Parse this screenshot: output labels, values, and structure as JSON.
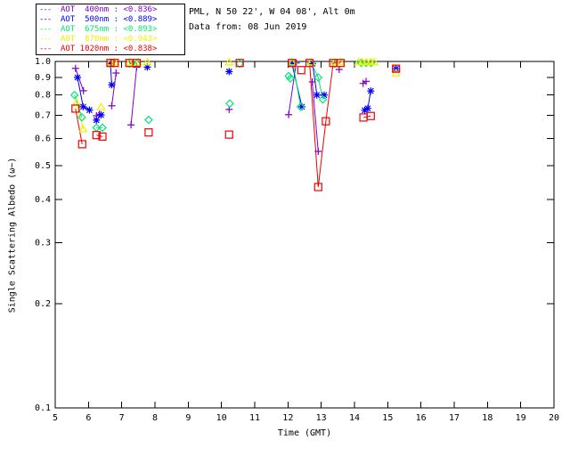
{
  "header": {
    "location_line": "PML, N 50 22', W 04 08', Alt 0m",
    "date_line": "Data from: 08 Jun 2019"
  },
  "legend": {
    "position": "top-left",
    "entries": [
      {
        "id": "aot-400",
        "dash": "---",
        "label": "AOT  400nm : <0.836>",
        "color": "#8000C8"
      },
      {
        "id": "aot-500",
        "dash": "---",
        "label": "AOT  500nm : <0.889>",
        "color": "#0000FF"
      },
      {
        "id": "aot-675",
        "dash": "---",
        "label": "AOT  675nm : <0.893>",
        "color": "#00E673"
      },
      {
        "id": "aot-870",
        "dash": "---",
        "label": "AOT  870nm : <0.943>",
        "color": "#F0F000"
      },
      {
        "id": "aot-1020",
        "dash": "---",
        "label": "AOT 1020nm : <0.838>",
        "color": "#F00000"
      }
    ]
  },
  "chart_data": {
    "type": "scatter",
    "title": "",
    "xlabel": "Time (GMT)",
    "ylabel": "Single Scattering Albedo (ω~)",
    "x_ticks": [
      "5",
      "6",
      "7",
      "8",
      "9",
      "10",
      "11",
      "12",
      "13",
      "14",
      "15",
      "16",
      "17",
      "18",
      "19",
      "20"
    ],
    "y_ticks": [
      "1.0",
      "0.9",
      "0.8",
      "0.7",
      "0.6",
      "0.5",
      "0.4",
      "0.3",
      "0.2",
      "0.1"
    ],
    "xlim": [
      5,
      20
    ],
    "ylim": [
      0.1,
      1.0
    ],
    "y_scale": "log",
    "grid": false,
    "axis_color": "#000000",
    "background": "#ffffff",
    "series": [
      {
        "name": "AOT 400nm",
        "wavelength": "400nm",
        "mean_label": "<0.836>",
        "color": "#8000C8",
        "marker": "plus",
        "segments": [
          [
            [
              5.61,
              0.955
            ],
            [
              5.85,
              0.823
            ]
          ],
          [
            [
              6.24,
              0.697
            ],
            [
              6.33,
              0.704
            ]
          ],
          [
            [
              6.7,
              0.745
            ],
            [
              6.83,
              0.926
            ]
          ],
          [
            [
              7.28,
              0.656
            ],
            [
              7.45,
              0.963
            ]
          ],
          [
            [
              10.23,
              0.727
            ]
          ],
          [
            [
              12.02,
              0.702
            ],
            [
              12.25,
              0.99
            ]
          ],
          [
            [
              12.73,
              0.873
            ],
            [
              12.91,
              0.55
            ]
          ],
          [
            [
              13.54,
              0.948
            ]
          ],
          [
            [
              14.26,
              0.864
            ],
            [
              14.35,
              0.876
            ]
          ]
        ]
      },
      {
        "name": "AOT 500nm",
        "wavelength": "500nm",
        "mean_label": "<0.889>",
        "color": "#0000FF",
        "marker": "asterisk",
        "segments": [
          [
            [
              5.67,
              0.899
            ],
            [
              5.84,
              0.74
            ],
            [
              6.03,
              0.724
            ]
          ],
          [
            [
              6.24,
              0.677
            ],
            [
              6.38,
              0.701
            ]
          ],
          [
            [
              6.66,
              0.985
            ],
            [
              6.7,
              0.856
            ]
          ],
          [
            [
              7.77,
              0.963
            ]
          ],
          [
            [
              10.23,
              0.935
            ]
          ],
          [
            [
              12.12,
              0.985
            ],
            [
              12.42,
              0.74
            ]
          ],
          [
            [
              12.74,
              0.985
            ],
            [
              12.87,
              0.8
            ],
            [
              13.09,
              0.8
            ]
          ],
          [
            [
              14.31,
              0.723
            ],
            [
              14.4,
              0.732
            ],
            [
              14.49,
              0.822
            ]
          ],
          [
            [
              15.25,
              0.953
            ]
          ]
        ]
      },
      {
        "name": "AOT 675nm",
        "wavelength": "675nm",
        "mean_label": "<0.893>",
        "color": "#00E673",
        "marker": "diamond",
        "segments": [
          [
            [
              5.58,
              0.8
            ],
            [
              5.8,
              0.69
            ]
          ],
          [
            [
              6.24,
              0.644
            ],
            [
              6.42,
              0.644
            ]
          ],
          [
            [
              6.66,
              0.985
            ]
          ],
          [
            [
              7.23,
              0.985
            ],
            [
              7.45,
              0.985
            ]
          ],
          [
            [
              7.81,
              0.678
            ]
          ],
          [
            [
              10.25,
              0.756
            ]
          ],
          [
            [
              10.55,
              0.985
            ]
          ],
          [
            [
              12.02,
              0.908
            ],
            [
              12.07,
              0.893
            ]
          ],
          [
            [
              12.15,
              0.99
            ],
            [
              12.38,
              0.74
            ]
          ],
          [
            [
              12.7,
              0.99
            ],
            [
              12.91,
              0.899
            ],
            [
              13.05,
              0.777
            ]
          ],
          [
            [
              13.41,
              0.985
            ]
          ],
          [
            [
              14.2,
              0.99
            ],
            [
              14.35,
              0.99
            ],
            [
              14.5,
              0.99
            ]
          ]
        ]
      },
      {
        "name": "AOT 870nm",
        "wavelength": "870nm",
        "mean_label": "<0.943>",
        "color": "#F0F000",
        "marker": "triangle",
        "segments": [
          [
            [
              5.64,
              0.76
            ],
            [
              5.84,
              0.638
            ]
          ],
          [
            [
              6.38,
              0.739
            ]
          ],
          [
            [
              6.66,
              0.995
            ],
            [
              6.79,
              0.995
            ]
          ],
          [
            [
              7.23,
              0.995
            ]
          ],
          [
            [
              7.5,
              0.995
            ]
          ],
          [
            [
              7.77,
              0.995
            ]
          ],
          [
            [
              10.23,
              0.995
            ]
          ],
          [
            [
              12.12,
              0.995
            ]
          ],
          [
            [
              12.7,
              0.995
            ]
          ],
          [
            [
              13.41,
              0.995
            ]
          ],
          [
            [
              13.58,
              0.995
            ]
          ],
          [
            [
              14.12,
              0.995
            ],
            [
              14.24,
              0.995
            ],
            [
              14.36,
              0.995
            ],
            [
              14.48,
              0.995
            ],
            [
              14.6,
              0.995
            ]
          ],
          [
            [
              15.25,
              0.926
            ]
          ]
        ]
      },
      {
        "name": "AOT 1020nm",
        "wavelength": "1020nm",
        "mean_label": "<0.838>",
        "color": "#F00000",
        "marker": "square",
        "segments": [
          [
            [
              5.61,
              0.731
            ],
            [
              5.81,
              0.577
            ]
          ],
          [
            [
              6.24,
              0.613
            ],
            [
              6.42,
              0.607
            ]
          ],
          [
            [
              6.66,
              0.99
            ],
            [
              6.79,
              0.99
            ]
          ],
          [
            [
              7.23,
              0.99
            ],
            [
              7.45,
              0.99
            ]
          ],
          [
            [
              7.81,
              0.624
            ]
          ],
          [
            [
              10.23,
              0.615
            ]
          ],
          [
            [
              10.55,
              0.99
            ]
          ],
          [
            [
              12.12,
              0.99
            ]
          ],
          [
            [
              12.4,
              0.944
            ]
          ],
          [
            [
              12.65,
              0.99
            ],
            [
              12.91,
              0.434
            ],
            [
              13.14,
              0.672
            ],
            [
              13.36,
              0.99
            ],
            [
              13.58,
              0.99
            ]
          ],
          [
            [
              14.27,
              0.689
            ],
            [
              14.49,
              0.696
            ]
          ],
          [
            [
              15.25,
              0.953
            ]
          ]
        ]
      }
    ]
  }
}
